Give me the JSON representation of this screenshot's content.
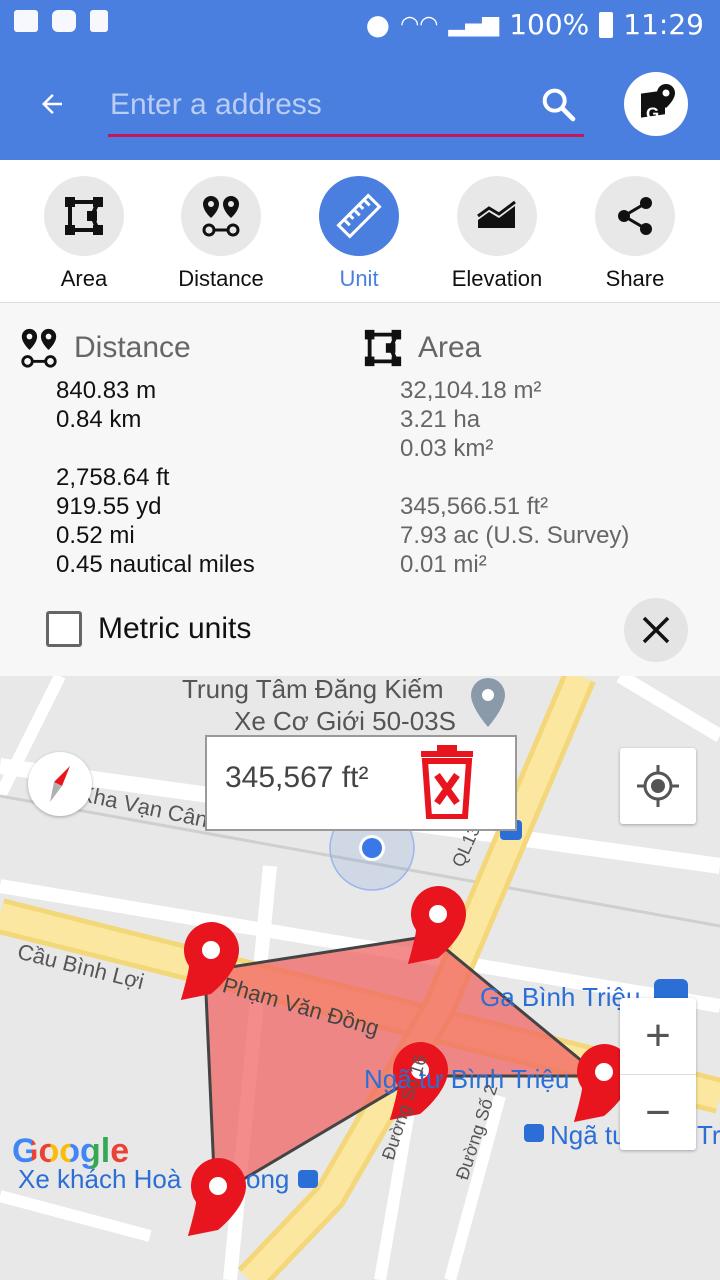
{
  "status": {
    "battery": "100%",
    "time": "11:29"
  },
  "appbar": {
    "search_placeholder": "Enter a address"
  },
  "tools": [
    {
      "label": "Area",
      "icon": "area-icon"
    },
    {
      "label": "Distance",
      "icon": "distance-icon"
    },
    {
      "label": "Unit",
      "icon": "ruler-icon",
      "active": true
    },
    {
      "label": "Elevation",
      "icon": "elevation-icon"
    },
    {
      "label": "Share",
      "icon": "share-icon"
    }
  ],
  "distance": {
    "title": "Distance",
    "values": [
      "840.83 m",
      "0.84 km",
      "",
      "2,758.64 ft",
      "919.55 yd",
      "0.52 mi",
      "0.45 nautical miles"
    ]
  },
  "area": {
    "title": "Area",
    "values": [
      "32,104.18 m²",
      "3.21 ha",
      "0.03 km²",
      "",
      "345,566.51 ft²",
      "7.93 ac (U.S. Survey)",
      "0.01 mi²"
    ]
  },
  "metric_units": {
    "label": "Metric units",
    "checked": false
  },
  "map": {
    "popup_value": "345,567 ft²",
    "labels": {
      "poi": "Trung Tâm Đăng Kiếm",
      "poi2": "Xe Cơ Giới 50-03S",
      "kha_van_can": "Kha Vạn Cân",
      "cau_binh_loi": "Cầu Bình Lợi",
      "pham_van_dong": "Phạm Văn Đồng",
      "ga_binh_trieu": "Ga Bình Triệu",
      "nga_tu": "Ngã tư Bình Triệu",
      "nga_tu_binh": "Ngã tư Bình Tr",
      "xe_khach": "Xe khách Hoà",
      "ong": "ong",
      "duong16": "Đường Số 16",
      "duong2": "Đường Số 2",
      "ql13": "QL13"
    },
    "zoom_in": "+",
    "zoom_out": "−",
    "google": "Google",
    "colors": {
      "polygon": "#f06060",
      "pin": "#e8141e",
      "accent": "#4a7fe0"
    }
  }
}
